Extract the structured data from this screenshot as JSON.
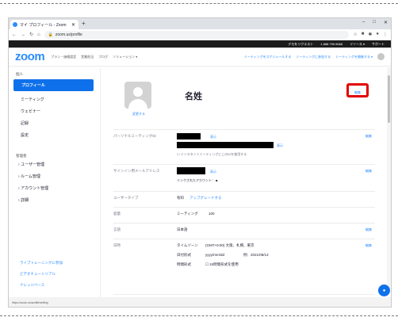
{
  "browser": {
    "tab_title": "マイ プロフィール - Zoom",
    "url": "zoom.us/profile"
  },
  "topbar": [
    "デモをリクエスト",
    "1.888.799.9666",
    "リソース ▾",
    "サポート"
  ],
  "header": {
    "logo": "zoom",
    "nav": [
      "プラン・価格設定",
      "営業担当",
      "ブログ",
      "ソリューション ▾"
    ],
    "right_links": [
      "ミーティングをスケジュールする",
      "ミーティングに参加する",
      "ミーティングを開催する ▾"
    ]
  },
  "sidebar": {
    "personal_heading": "個人",
    "personal_items": [
      "プロフィール",
      "ミーティング",
      "ウェビナー",
      "記録",
      "設定"
    ],
    "admin_heading": "管理者",
    "admin_items": [
      "ユーザー管理",
      "ルーム管理",
      "アカウント管理",
      "詳細"
    ],
    "links": [
      "ライブトレーニングに参加",
      "ビデオチュートリアル",
      "ナレッジベース"
    ],
    "bottom_text": "https://zoom.us/profile/setting"
  },
  "profile": {
    "name": "名姓",
    "change_avatar": "変更する",
    "edit": "編集",
    "rows": [
      {
        "label": "パーソナルミーティングID",
        "value": "",
        "sub": "インスタントミーティングにこのIDを使用する",
        "link": "表示",
        "edit": "編集"
      },
      {
        "label": "サインイン用メールアドレス",
        "value": "",
        "sub": "リンクされたアカウント：",
        "link": "表示",
        "edit": "編集"
      },
      {
        "label": "ユーザータイプ",
        "value": "有料",
        "link": "アップグレードする",
        "edit": ""
      },
      {
        "label": "容量",
        "value": "ミーティング",
        "sub": "100",
        "edit": ""
      },
      {
        "label": "言語",
        "value": "日本語",
        "edit": "編集"
      },
      {
        "label": "日時",
        "values": [
          [
            "タイムゾーン",
            "(GMT+9:00) 大阪、札幌、東京"
          ],
          [
            "日付形式",
            "yyyy/mm/dd",
            "例：2021/08/13"
          ],
          [
            "時間形式",
            "24時間形式を使用"
          ]
        ],
        "edit": "編集"
      },
      {
        "label": "カレンダーと連絡先の統合",
        "value": "We support the following services: Google Calendar, Microsoft Exchange and Microsoft Office 365"
      }
    ]
  },
  "colors": {
    "accent": "#0e71eb",
    "link": "#2d8cff",
    "highlight": "#e20000"
  }
}
